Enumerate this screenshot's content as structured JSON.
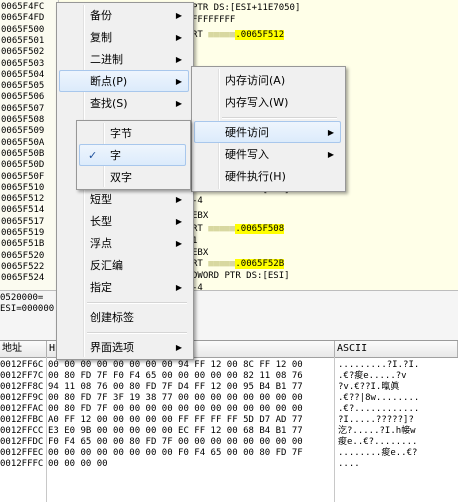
{
  "disasm": {
    "addresses": [
      "0065F4FC",
      "0065F4FD",
      "0065F500",
      "0065F501",
      "0065F502",
      "0065F503",
      "0065F504",
      "0065F505",
      "0065F506",
      "0065F507",
      "0065F508",
      "0065F509",
      "0065F50A",
      "0065F50B",
      "0065F50D",
      "0065F50F",
      "0065F510",
      "0065F512",
      "0065F514",
      "0065F517",
      "0065F519",
      "0065F51B",
      "0065F520",
      "0065F522",
      "0065F524"
    ],
    "code_fragments": [
      {
        "text": "PTR DS:[ESI+11E7050]"
      },
      {
        "text": "FFFFFFFF"
      },
      {
        "text": "RT ",
        "blur": "■■■■■",
        "hl": ".0065F512"
      },
      {
        "text": "DWORD PTR DS:[ESI]"
      },
      {
        "text": "-4"
      },
      {
        "text": "EBX"
      },
      {
        "text": "RT ",
        "blur": "■■■■■",
        "hl": ".0065F508"
      },
      {
        "text": "1"
      },
      {
        "text": "EBX"
      },
      {
        "text": "RT ",
        "blur": "■■■■■",
        "hl": ".0065F52B"
      },
      {
        "text": "DWORD PTR DS:[ESI]"
      },
      {
        "text": "-4"
      }
    ]
  },
  "info": {
    "lines": [
      "0520000=",
      "ESI=000000"
    ]
  },
  "dump": {
    "headers": {
      "address": "地址",
      "hex": "HEX",
      "ascii": "ASCII"
    },
    "rows": [
      {
        "addr": "0012FF6C",
        "hex": "00 00 00 00 00 00 00 00 94 FF 12 00 8C FF 12 00",
        "ascii": ".........?I.?I."
      },
      {
        "addr": "0012FF7C",
        "hex": "00 80 FD 7F F0 F4 65 00 00 00 00 00 82 11 08 76",
        "ascii": ".€?痠e.....?v"
      },
      {
        "addr": "0012FF8C",
        "hex": "94 11 08 76 00 80 FD 7F D4 FF 12 00 95 B4 B1 77",
        "ascii": "?v.€??I.暣眞"
      },
      {
        "addr": "0012FF9C",
        "hex": "00 80 FD 7F 3F 19 38 77 00 00 00 00 00 00 00 00",
        "ascii": ".€??|8w........"
      },
      {
        "addr": "0012FFAC",
        "hex": "00 80 FD 7F 00 00 00 00 00 00 00 00 00 00 00 00",
        "ascii": ".€?............"
      },
      {
        "addr": "0012FFBC",
        "hex": "A0 FF 12 00 00 00 00 00 FF FF FF FF 5D D7 AD 77",
        "ascii": "?I.....?????]?"
      },
      {
        "addr": "0012FFCC",
        "hex": "E3 E0 9B 00 00 00 00 00 EC FF 12 00 68 B4 B1 77",
        "ascii": "汔?.....?I.h帹w"
      },
      {
        "addr": "0012FFDC",
        "hex": "F0 F4 65 00 00 80 FD 7F 00 00 00 00 00 00 00 00",
        "ascii": "痠e..€?........"
      },
      {
        "addr": "0012FFEC",
        "hex": "00 00 00 00 00 00 00 00 F0 F4 65 00 00 80 FD 7F",
        "ascii": "........痠e..€?"
      },
      {
        "addr": "0012FFFC",
        "hex": "00 00 00 00",
        "ascii": "...."
      }
    ]
  },
  "main_menu": {
    "items": [
      {
        "label": "备份",
        "has_submenu": true
      },
      {
        "label": "复制",
        "has_submenu": true
      },
      {
        "label": "二进制",
        "has_submenu": true
      },
      {
        "label": "断点(P)",
        "has_submenu": true
      },
      {
        "label": "查找(S)",
        "has_submenu": true
      },
      {
        "label": "短型",
        "has_submenu": true
      },
      {
        "label": "长型",
        "has_submenu": true
      },
      {
        "label": "浮点",
        "has_submenu": true
      },
      {
        "label": "反汇编",
        "has_submenu": false
      },
      {
        "label": "指定",
        "has_submenu": true
      },
      {
        "label": "创建标签",
        "has_submenu": false
      },
      {
        "label": "界面选项",
        "has_submenu": true
      }
    ]
  },
  "breakpoint_menu": {
    "items": [
      {
        "label": "内存访问(A)",
        "has_submenu": false
      },
      {
        "label": "内存写入(W)",
        "has_submenu": false
      },
      {
        "label": "硬件访问",
        "has_submenu": true
      },
      {
        "label": "硬件写入",
        "has_submenu": true
      },
      {
        "label": "硬件执行(H)",
        "has_submenu": false
      }
    ]
  },
  "size_menu": {
    "items": [
      {
        "label": "字节",
        "checked": false
      },
      {
        "label": "字",
        "checked": true
      },
      {
        "label": "双字",
        "checked": false
      }
    ],
    "check_glyph": "✓"
  },
  "icons": {
    "submenu_arrow": "▶"
  }
}
